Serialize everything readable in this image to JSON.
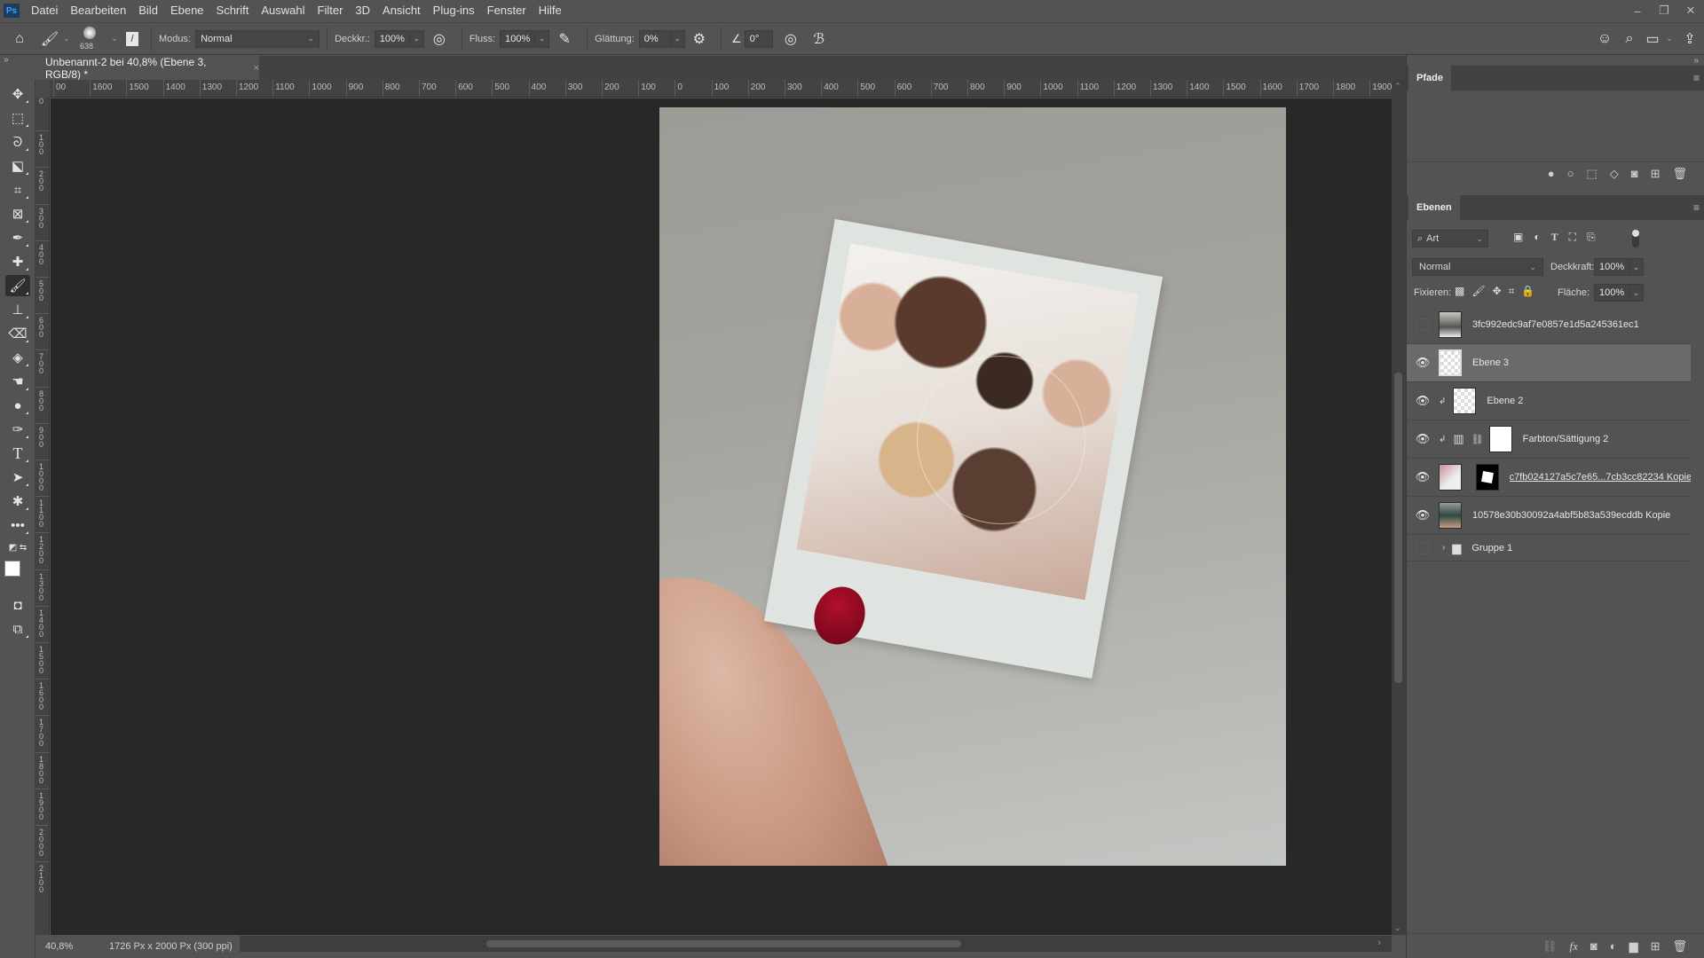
{
  "app": {
    "logo": "Ps",
    "menu": [
      "Datei",
      "Bearbeiten",
      "Bild",
      "Ebene",
      "Schrift",
      "Auswahl",
      "Filter",
      "3D",
      "Ansicht",
      "Plug-ins",
      "Fenster",
      "Hilfe"
    ],
    "window_controls": {
      "minimize": "–",
      "restore": "❐",
      "close": "✕"
    }
  },
  "options": {
    "brush_size": "638",
    "mode_label": "Modus:",
    "mode_value": "Normal",
    "opacity_label": "Deckkr.:",
    "opacity_value": "100%",
    "flow_label": "Fluss:",
    "flow_value": "100%",
    "smoothing_label": "Glättung:",
    "smoothing_value": "0%",
    "angle_value": "0°"
  },
  "document": {
    "tab_title": "Unbenannt-2 bei 40,8% (Ebene 3, RGB/8) *",
    "close": "×",
    "zoom": "40,8%",
    "dimensions": "1726 Px x 2000 Px (300 ppi)"
  },
  "ruler": {
    "top": [
      "00",
      "1600",
      "1500",
      "1400",
      "1300",
      "1200",
      "1100",
      "1000",
      "900",
      "800",
      "700",
      "600",
      "500",
      "400",
      "300",
      "200",
      "100",
      "0",
      "100",
      "200",
      "300",
      "400",
      "500",
      "600",
      "700",
      "800",
      "900",
      "1000",
      "1100",
      "1200",
      "1300",
      "1400",
      "1500",
      "1600",
      "1700",
      "1800",
      "1900"
    ],
    "left": [
      "0",
      "100",
      "200",
      "300",
      "400",
      "500",
      "600",
      "700",
      "800",
      "900",
      "1000",
      "1100",
      "1200",
      "1300",
      "1400",
      "1500",
      "1600",
      "1700",
      "1800",
      "1900",
      "2000",
      "2100"
    ]
  },
  "paths_panel": {
    "title": "Pfade"
  },
  "layers_panel": {
    "title": "Ebenen",
    "filter_label": "Art",
    "blend_mode": "Normal",
    "opacity_label": "Deckkraft:",
    "opacity_value": "100%",
    "lock_label": "Fixieren:",
    "fill_label": "Fläche:",
    "fill_value": "100%",
    "layers": [
      {
        "name": "3fc992edc9af7e0857e1d5a245361ec1",
        "visible": false,
        "type": "smart-object"
      },
      {
        "name": "Ebene 3",
        "visible": true,
        "type": "pixel",
        "selected": true
      },
      {
        "name": "Ebene 2",
        "visible": true,
        "type": "pixel",
        "clipped": true
      },
      {
        "name": "Farbton/Sättigung 2",
        "visible": true,
        "type": "adjustment",
        "clipped": true
      },
      {
        "name": "c7fb024127a5c7e65...7cb3cc82234 Kopie",
        "visible": true,
        "type": "smart-object-masked"
      },
      {
        "name": "10578e30b30092a4abf5b83a539ecddb  Kopie",
        "visible": true,
        "type": "smart-object"
      },
      {
        "name": "Gruppe 1",
        "visible": false,
        "type": "group"
      }
    ]
  },
  "colors": {
    "foreground": "#ffffff",
    "background": "#000000",
    "nail": "#8a0a20"
  }
}
